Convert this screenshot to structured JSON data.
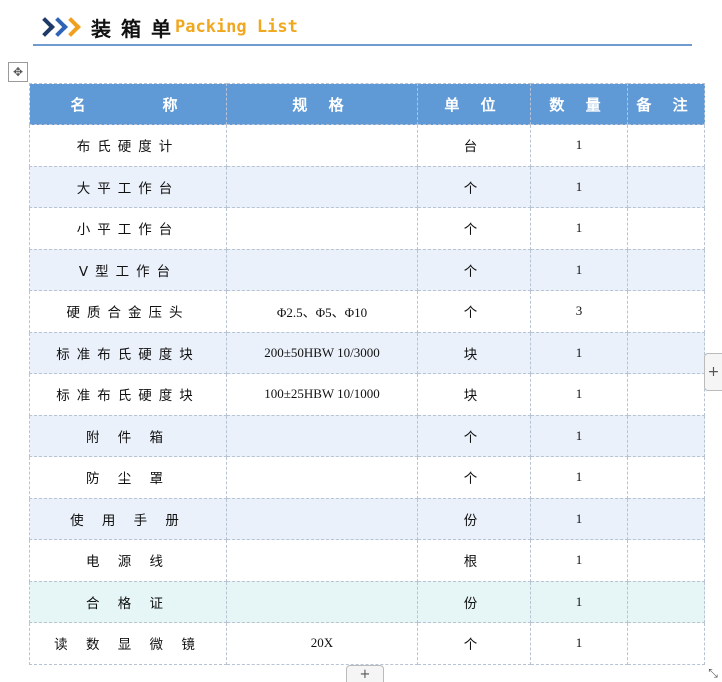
{
  "title": {
    "chinese": "装箱单",
    "english": "Packing List"
  },
  "columns": [
    "名　　　称",
    "规 格",
    "单 位",
    "数 量",
    "备 注"
  ],
  "rows": [
    {
      "name": "布氏硬度计",
      "spec": "",
      "unit": "台",
      "qty": "1",
      "note": "",
      "shade": "plain"
    },
    {
      "name": "大平工作台",
      "spec": "",
      "unit": "个",
      "qty": "1",
      "note": "",
      "shade": "blue"
    },
    {
      "name": "小平工作台",
      "spec": "",
      "unit": "个",
      "qty": "1",
      "note": "",
      "shade": "plain"
    },
    {
      "name": "V型工作台",
      "spec": "",
      "unit": "个",
      "qty": "1",
      "note": "",
      "shade": "blue"
    },
    {
      "name": "硬质合金压头",
      "spec": "Φ2.5、Φ5、Φ10",
      "unit": "个",
      "qty": "3",
      "note": "",
      "shade": "plain"
    },
    {
      "name": "标准布氏硬度块",
      "spec": "200±50HBW 10/3000",
      "unit": "块",
      "qty": "1",
      "note": "",
      "shade": "blue"
    },
    {
      "name": "标准布氏硬度块",
      "spec": "100±25HBW 10/1000",
      "unit": "块",
      "qty": "1",
      "note": "",
      "shade": "plain"
    },
    {
      "name": "附 件 箱",
      "spec": "",
      "unit": "个",
      "qty": "1",
      "note": "",
      "shade": "blue"
    },
    {
      "name": "防 尘 罩",
      "spec": "",
      "unit": "个",
      "qty": "1",
      "note": "",
      "shade": "plain"
    },
    {
      "name": "使 用 手 册",
      "spec": "",
      "unit": "份",
      "qty": "1",
      "note": "",
      "shade": "blue"
    },
    {
      "name": "电 源 线",
      "spec": "",
      "unit": "根",
      "qty": "1",
      "note": "",
      "shade": "plain"
    },
    {
      "name": "合 格 证",
      "spec": "",
      "unit": "份",
      "qty": "1",
      "note": "",
      "shade": "teal"
    },
    {
      "name": "读 数 显 微 镜",
      "spec": "20X",
      "unit": "个",
      "qty": "1",
      "note": "",
      "shade": "plain"
    }
  ],
  "controls": {
    "move_icon": "move-arrows-icon",
    "add_column_glyph": "+",
    "add_row_glyph": "+",
    "resize_icon": "resize-diagonal-icon"
  },
  "colors": {
    "header_bg": "#5f9ad6",
    "row_alt": "#eaf1fa",
    "row_highlight": "#e6f5f6",
    "title_accent": "#f0a81e",
    "title_rule": "#6f9bd1"
  }
}
